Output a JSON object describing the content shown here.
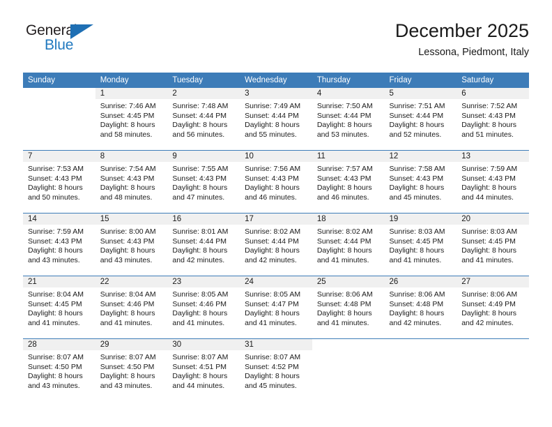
{
  "brand": {
    "name_top": "General",
    "name_bottom": "Blue",
    "triangle_color": "#1e6fb4",
    "text_color": "#231f20",
    "accent_color": "#2179bf"
  },
  "header": {
    "title": "December 2025",
    "subtitle": "Lessona, Piedmont, Italy"
  },
  "theme": {
    "header_row_bg": "#3d7cb8",
    "header_row_text": "#ffffff",
    "daynum_band_bg": "#f0f0f0",
    "cell_bg": "#ffffff",
    "row_divider": "#3d7cb8"
  },
  "weekdays": [
    "Sunday",
    "Monday",
    "Tuesday",
    "Wednesday",
    "Thursday",
    "Friday",
    "Saturday"
  ],
  "weeks": [
    [
      {
        "day": "",
        "sunrise": "",
        "sunset": "",
        "daylight_line1": "",
        "daylight_line2": ""
      },
      {
        "day": "1",
        "sunrise": "Sunrise: 7:46 AM",
        "sunset": "Sunset: 4:45 PM",
        "daylight_line1": "Daylight: 8 hours",
        "daylight_line2": "and 58 minutes."
      },
      {
        "day": "2",
        "sunrise": "Sunrise: 7:48 AM",
        "sunset": "Sunset: 4:44 PM",
        "daylight_line1": "Daylight: 8 hours",
        "daylight_line2": "and 56 minutes."
      },
      {
        "day": "3",
        "sunrise": "Sunrise: 7:49 AM",
        "sunset": "Sunset: 4:44 PM",
        "daylight_line1": "Daylight: 8 hours",
        "daylight_line2": "and 55 minutes."
      },
      {
        "day": "4",
        "sunrise": "Sunrise: 7:50 AM",
        "sunset": "Sunset: 4:44 PM",
        "daylight_line1": "Daylight: 8 hours",
        "daylight_line2": "and 53 minutes."
      },
      {
        "day": "5",
        "sunrise": "Sunrise: 7:51 AM",
        "sunset": "Sunset: 4:44 PM",
        "daylight_line1": "Daylight: 8 hours",
        "daylight_line2": "and 52 minutes."
      },
      {
        "day": "6",
        "sunrise": "Sunrise: 7:52 AM",
        "sunset": "Sunset: 4:43 PM",
        "daylight_line1": "Daylight: 8 hours",
        "daylight_line2": "and 51 minutes."
      }
    ],
    [
      {
        "day": "7",
        "sunrise": "Sunrise: 7:53 AM",
        "sunset": "Sunset: 4:43 PM",
        "daylight_line1": "Daylight: 8 hours",
        "daylight_line2": "and 50 minutes."
      },
      {
        "day": "8",
        "sunrise": "Sunrise: 7:54 AM",
        "sunset": "Sunset: 4:43 PM",
        "daylight_line1": "Daylight: 8 hours",
        "daylight_line2": "and 48 minutes."
      },
      {
        "day": "9",
        "sunrise": "Sunrise: 7:55 AM",
        "sunset": "Sunset: 4:43 PM",
        "daylight_line1": "Daylight: 8 hours",
        "daylight_line2": "and 47 minutes."
      },
      {
        "day": "10",
        "sunrise": "Sunrise: 7:56 AM",
        "sunset": "Sunset: 4:43 PM",
        "daylight_line1": "Daylight: 8 hours",
        "daylight_line2": "and 46 minutes."
      },
      {
        "day": "11",
        "sunrise": "Sunrise: 7:57 AM",
        "sunset": "Sunset: 4:43 PM",
        "daylight_line1": "Daylight: 8 hours",
        "daylight_line2": "and 46 minutes."
      },
      {
        "day": "12",
        "sunrise": "Sunrise: 7:58 AM",
        "sunset": "Sunset: 4:43 PM",
        "daylight_line1": "Daylight: 8 hours",
        "daylight_line2": "and 45 minutes."
      },
      {
        "day": "13",
        "sunrise": "Sunrise: 7:59 AM",
        "sunset": "Sunset: 4:43 PM",
        "daylight_line1": "Daylight: 8 hours",
        "daylight_line2": "and 44 minutes."
      }
    ],
    [
      {
        "day": "14",
        "sunrise": "Sunrise: 7:59 AM",
        "sunset": "Sunset: 4:43 PM",
        "daylight_line1": "Daylight: 8 hours",
        "daylight_line2": "and 43 minutes."
      },
      {
        "day": "15",
        "sunrise": "Sunrise: 8:00 AM",
        "sunset": "Sunset: 4:43 PM",
        "daylight_line1": "Daylight: 8 hours",
        "daylight_line2": "and 43 minutes."
      },
      {
        "day": "16",
        "sunrise": "Sunrise: 8:01 AM",
        "sunset": "Sunset: 4:44 PM",
        "daylight_line1": "Daylight: 8 hours",
        "daylight_line2": "and 42 minutes."
      },
      {
        "day": "17",
        "sunrise": "Sunrise: 8:02 AM",
        "sunset": "Sunset: 4:44 PM",
        "daylight_line1": "Daylight: 8 hours",
        "daylight_line2": "and 42 minutes."
      },
      {
        "day": "18",
        "sunrise": "Sunrise: 8:02 AM",
        "sunset": "Sunset: 4:44 PM",
        "daylight_line1": "Daylight: 8 hours",
        "daylight_line2": "and 41 minutes."
      },
      {
        "day": "19",
        "sunrise": "Sunrise: 8:03 AM",
        "sunset": "Sunset: 4:45 PM",
        "daylight_line1": "Daylight: 8 hours",
        "daylight_line2": "and 41 minutes."
      },
      {
        "day": "20",
        "sunrise": "Sunrise: 8:03 AM",
        "sunset": "Sunset: 4:45 PM",
        "daylight_line1": "Daylight: 8 hours",
        "daylight_line2": "and 41 minutes."
      }
    ],
    [
      {
        "day": "21",
        "sunrise": "Sunrise: 8:04 AM",
        "sunset": "Sunset: 4:45 PM",
        "daylight_line1": "Daylight: 8 hours",
        "daylight_line2": "and 41 minutes."
      },
      {
        "day": "22",
        "sunrise": "Sunrise: 8:04 AM",
        "sunset": "Sunset: 4:46 PM",
        "daylight_line1": "Daylight: 8 hours",
        "daylight_line2": "and 41 minutes."
      },
      {
        "day": "23",
        "sunrise": "Sunrise: 8:05 AM",
        "sunset": "Sunset: 4:46 PM",
        "daylight_line1": "Daylight: 8 hours",
        "daylight_line2": "and 41 minutes."
      },
      {
        "day": "24",
        "sunrise": "Sunrise: 8:05 AM",
        "sunset": "Sunset: 4:47 PM",
        "daylight_line1": "Daylight: 8 hours",
        "daylight_line2": "and 41 minutes."
      },
      {
        "day": "25",
        "sunrise": "Sunrise: 8:06 AM",
        "sunset": "Sunset: 4:48 PM",
        "daylight_line1": "Daylight: 8 hours",
        "daylight_line2": "and 41 minutes."
      },
      {
        "day": "26",
        "sunrise": "Sunrise: 8:06 AM",
        "sunset": "Sunset: 4:48 PM",
        "daylight_line1": "Daylight: 8 hours",
        "daylight_line2": "and 42 minutes."
      },
      {
        "day": "27",
        "sunrise": "Sunrise: 8:06 AM",
        "sunset": "Sunset: 4:49 PM",
        "daylight_line1": "Daylight: 8 hours",
        "daylight_line2": "and 42 minutes."
      }
    ],
    [
      {
        "day": "28",
        "sunrise": "Sunrise: 8:07 AM",
        "sunset": "Sunset: 4:50 PM",
        "daylight_line1": "Daylight: 8 hours",
        "daylight_line2": "and 43 minutes."
      },
      {
        "day": "29",
        "sunrise": "Sunrise: 8:07 AM",
        "sunset": "Sunset: 4:50 PM",
        "daylight_line1": "Daylight: 8 hours",
        "daylight_line2": "and 43 minutes."
      },
      {
        "day": "30",
        "sunrise": "Sunrise: 8:07 AM",
        "sunset": "Sunset: 4:51 PM",
        "daylight_line1": "Daylight: 8 hours",
        "daylight_line2": "and 44 minutes."
      },
      {
        "day": "31",
        "sunrise": "Sunrise: 8:07 AM",
        "sunset": "Sunset: 4:52 PM",
        "daylight_line1": "Daylight: 8 hours",
        "daylight_line2": "and 45 minutes."
      },
      {
        "day": "",
        "sunrise": "",
        "sunset": "",
        "daylight_line1": "",
        "daylight_line2": ""
      },
      {
        "day": "",
        "sunrise": "",
        "sunset": "",
        "daylight_line1": "",
        "daylight_line2": ""
      },
      {
        "day": "",
        "sunrise": "",
        "sunset": "",
        "daylight_line1": "",
        "daylight_line2": ""
      }
    ]
  ]
}
